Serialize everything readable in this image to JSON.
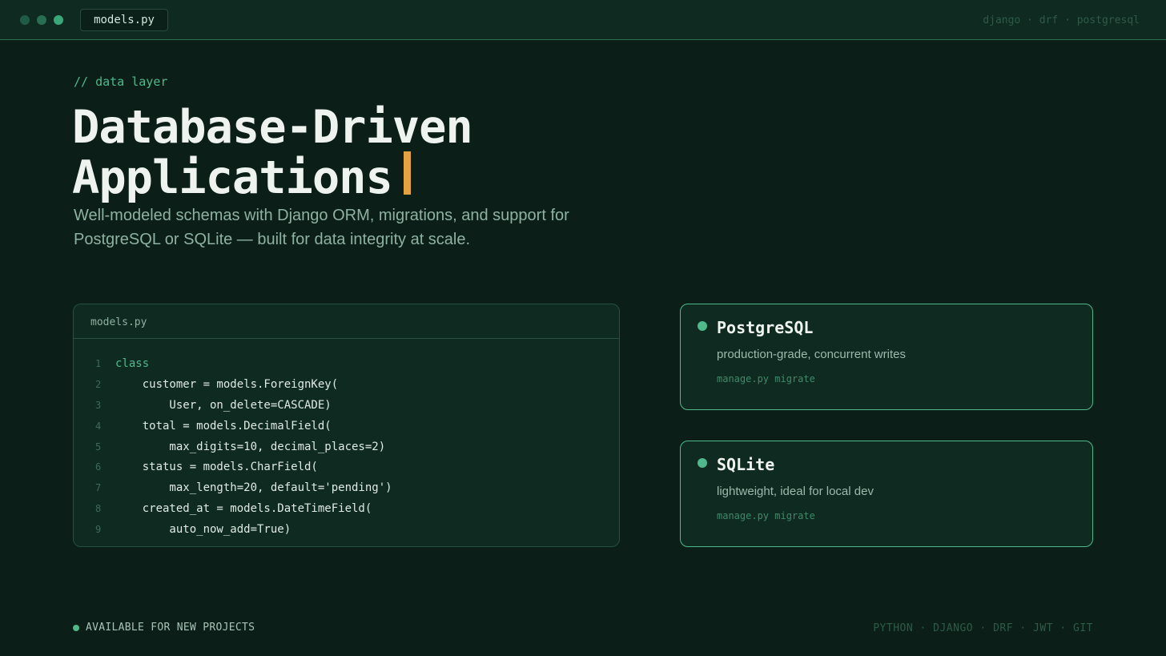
{
  "window": {
    "tab_label": "models.py",
    "meta": "django · drf · postgresql"
  },
  "hero": {
    "eyebrow": "// data layer",
    "headline_line1": "Database-Driven",
    "headline_line2": "Applications",
    "subtitle": "Well-modeled schemas with Django ORM, migrations, and support for PostgreSQL or SQLite — built for data integrity at scale."
  },
  "code_card": {
    "filename": "models.py",
    "lines": [
      {
        "num": "1",
        "text": "class"
      },
      {
        "num": "2",
        "text": "    customer = models.ForeignKey("
      },
      {
        "num": "3",
        "text": "        User, on_delete=CASCADE)"
      },
      {
        "num": "4",
        "text": "    total = models.DecimalField("
      },
      {
        "num": "5",
        "text": "        max_digits=10, decimal_places=2)"
      },
      {
        "num": "6",
        "text": "    status = models.CharField("
      },
      {
        "num": "7",
        "text": "        max_length=20, default='pending')"
      },
      {
        "num": "8",
        "text": "    created_at = models.DateTimeField("
      },
      {
        "num": "9",
        "text": "        auto_now_add=True)"
      }
    ]
  },
  "databases": [
    {
      "name": "PostgreSQL",
      "description": "production-grade, concurrent writes",
      "command": "manage.py migrate"
    },
    {
      "name": "SQLite",
      "description": "lightweight, ideal for local dev",
      "command": "manage.py migrate"
    }
  ],
  "footer": {
    "status": "AVAILABLE FOR NEW PROJECTS",
    "tech": "PYTHON · DJANGO · DRF · JWT · GIT"
  },
  "colors": {
    "background": "#0b1f18",
    "accent": "#4fb98c",
    "cursor": "#e3a343"
  }
}
